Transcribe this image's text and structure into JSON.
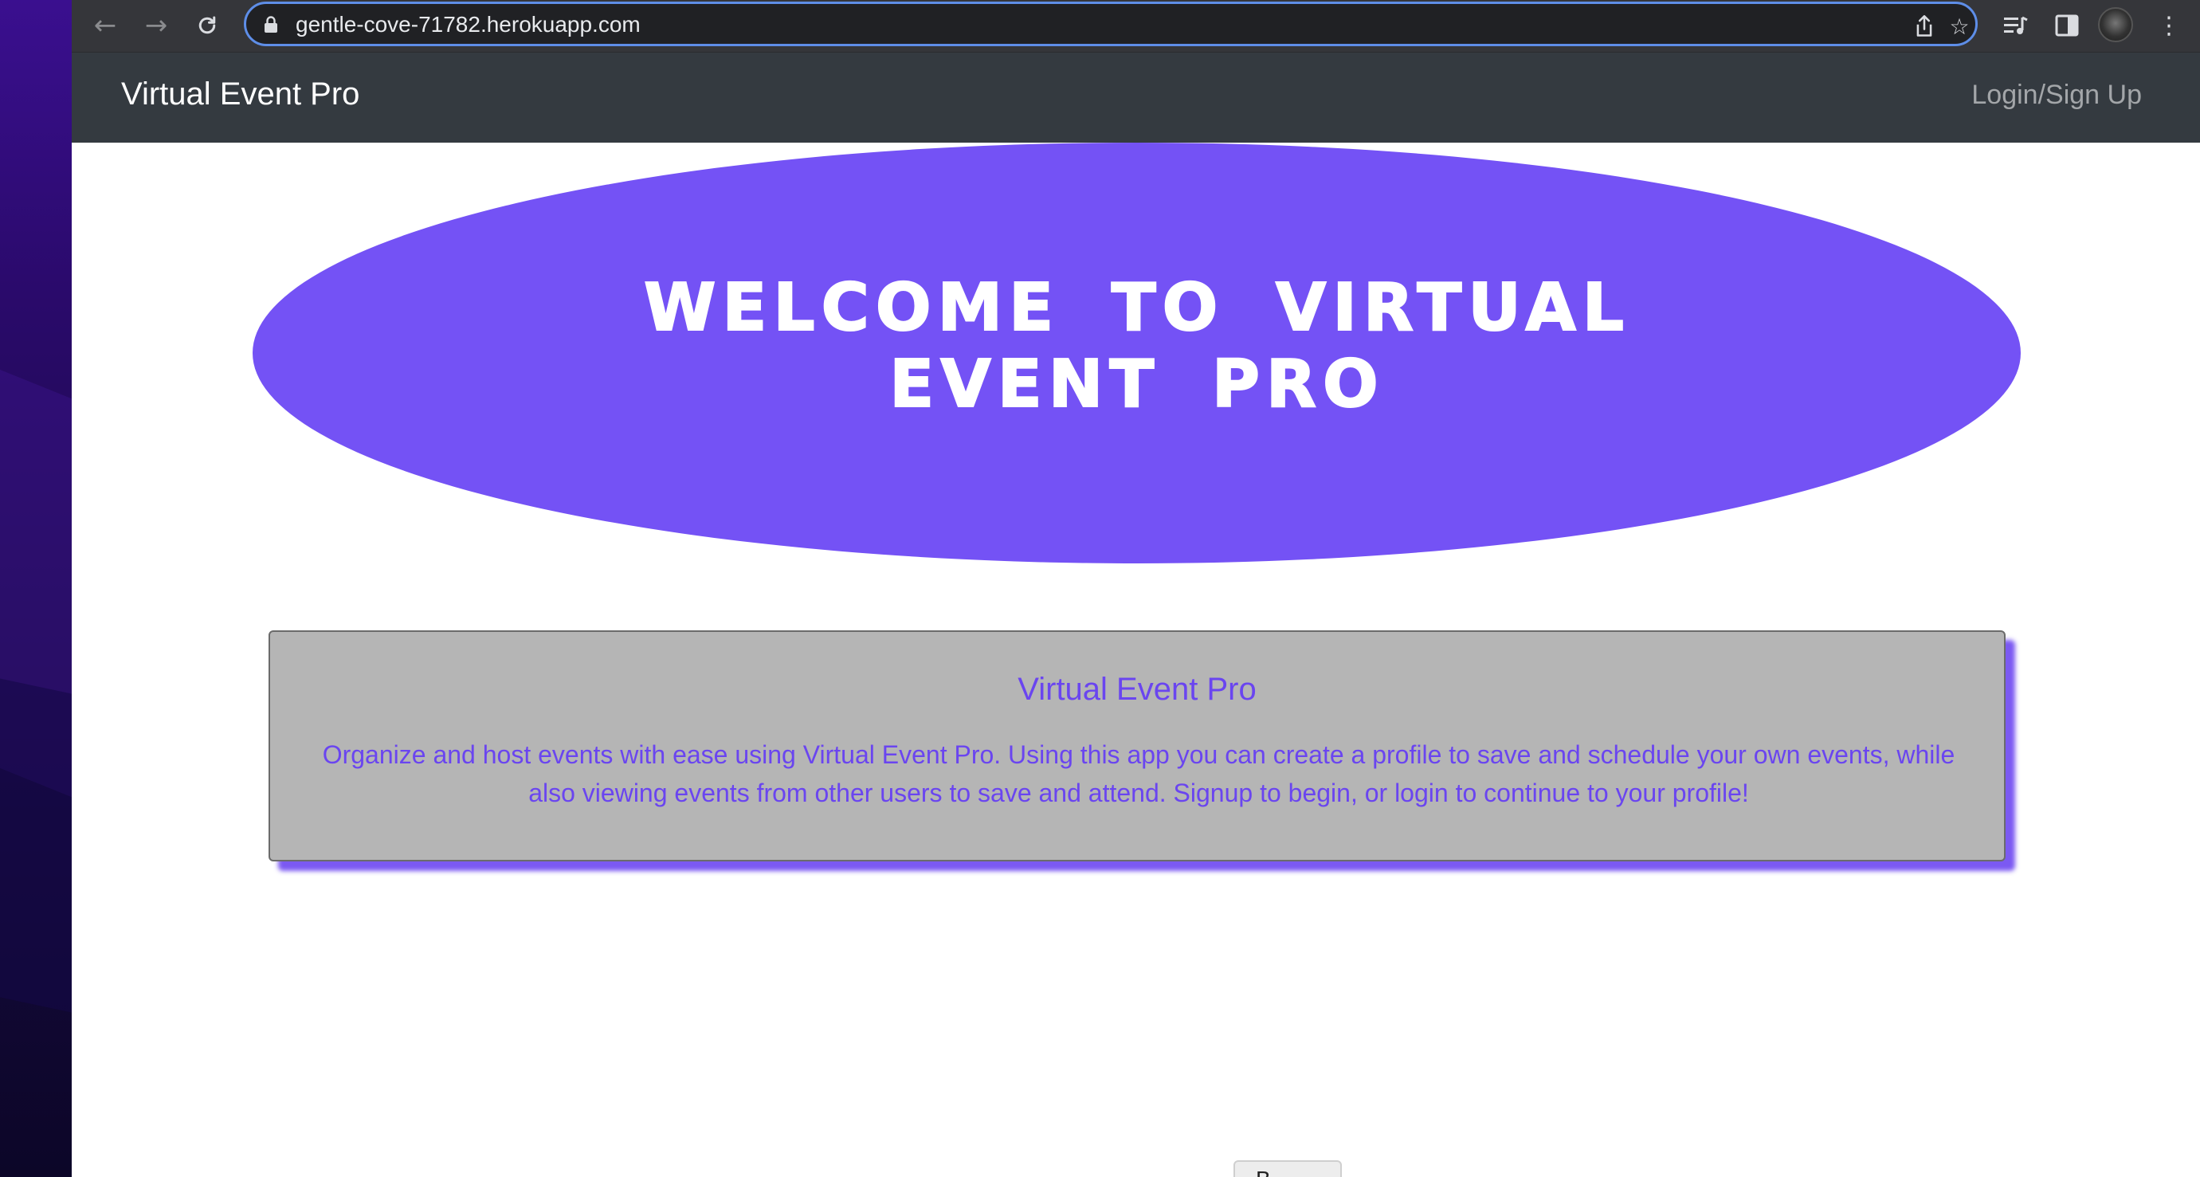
{
  "browser": {
    "url": "gentle-cove-71782.herokuapp.com",
    "icons": {
      "back": "arrow-left-icon",
      "forward": "arrow-right-icon",
      "reload": "reload-icon",
      "lock": "lock-icon",
      "share": "share-icon",
      "bookmark": "star-icon",
      "media": "media-queue-icon",
      "side_panel": "side-panel-icon",
      "menu": "kebab-menu-icon"
    }
  },
  "navbar": {
    "brand": "Virtual Event Pro",
    "login_link": "Login/Sign Up"
  },
  "hero": {
    "title": "Welcome to Virtual Event Pro"
  },
  "card": {
    "title": "Virtual Event Pro",
    "text": "Organize and host events with ease using Virtual Event Pro. Using this app you can create a profile to save and schedule your own events, while also viewing events from other users to save and attend. Signup to begin, or login to continue to your profile!"
  },
  "bottom_button": {
    "label": "B"
  },
  "colors": {
    "accent": "#7452f5",
    "card_text": "#6a45f0",
    "card_bg": "#b5b5b5",
    "navbar_bg": "#343a40"
  }
}
